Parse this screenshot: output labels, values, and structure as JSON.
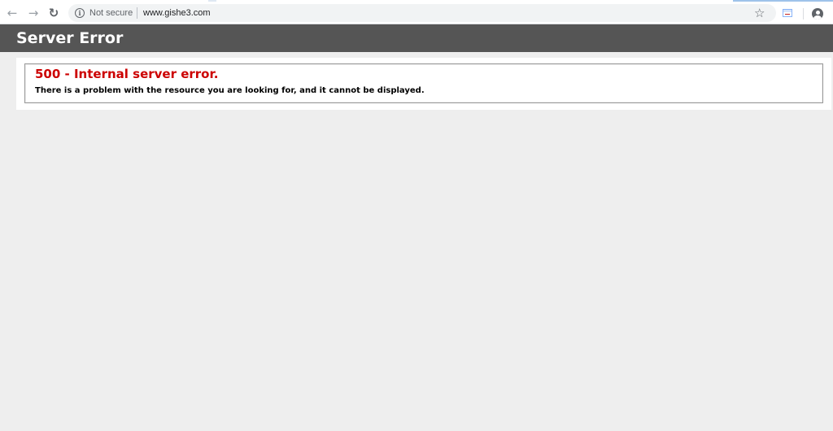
{
  "browser": {
    "back_icon": "arrow-left-icon",
    "forward_icon": "arrow-right-icon",
    "reload_icon": "reload-icon",
    "security_label": "Not secure",
    "url": "www.gishe3.com",
    "bookmark_icon": "star-icon",
    "extension_icon": "extension-icon",
    "profile_icon": "account-icon"
  },
  "page": {
    "header_title": "Server Error",
    "error_title": "500 - Internal server error.",
    "error_message": "There is a problem with the resource you are looking for, and it cannot be displayed."
  },
  "colors": {
    "header_background": "#555555",
    "error_title": "#cc0000",
    "page_background": "#eeeeee"
  }
}
